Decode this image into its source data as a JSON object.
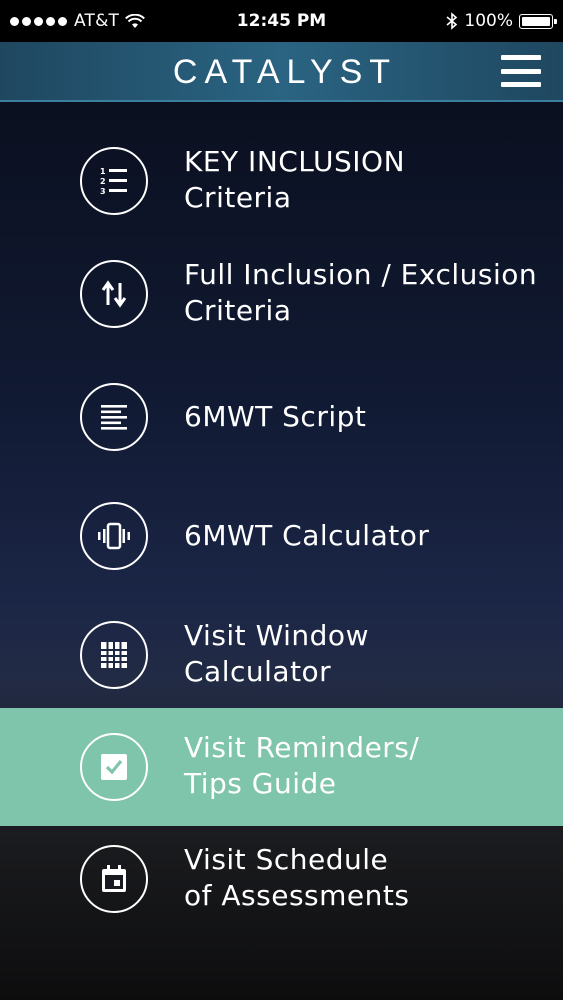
{
  "status_bar": {
    "carrier": "AT&T",
    "time": "12:45 PM",
    "battery": "100%"
  },
  "header": {
    "title": "CATALYST"
  },
  "menu": {
    "items": [
      {
        "line1": "KEY INCLUSION",
        "line2": "Criteria",
        "icon": "numbered-list-icon"
      },
      {
        "line1": "Full Inclusion / Exclusion",
        "line2": "Criteria",
        "icon": "up-down-arrows-icon"
      },
      {
        "line1": "6MWT Script",
        "line2": "",
        "icon": "text-lines-icon"
      },
      {
        "line1": "6MWT Calculator",
        "line2": "",
        "icon": "phone-vibrate-icon"
      },
      {
        "line1": "Visit Window",
        "line2": "Calculator",
        "icon": "grid-icon"
      },
      {
        "line1": "Visit Reminders/",
        "line2": "Tips Guide",
        "icon": "checkbox-icon"
      },
      {
        "line1": "Visit Schedule",
        "line2": "of Assessments",
        "icon": "calendar-icon"
      }
    ],
    "active_index": 5,
    "active_color": "#7fc5ab"
  }
}
